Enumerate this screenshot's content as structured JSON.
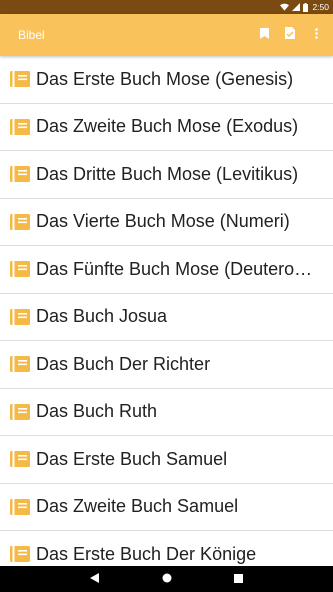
{
  "status_bar": {
    "time": "2:50"
  },
  "app_bar": {
    "title": "Bibel",
    "actions": [
      "bookmark-icon",
      "document-icon",
      "more-vert-icon"
    ]
  },
  "books": [
    "Das Erste Buch Mose (Genesis)",
    "Das Zweite Buch Mose (Exodus)",
    "Das Dritte Buch Mose (Levitikus)",
    "Das Vierte Buch Mose (Numeri)",
    "Das Fünfte Buch Mose (Deuteronomium)",
    "Das Buch Josua",
    "Das Buch Der Richter",
    "Das Buch Ruth",
    "Das Erste Buch Samuel",
    "Das Zweite Buch Samuel",
    "Das Erste Buch Der Könige"
  ],
  "colors": {
    "status_bar": "#7a4a12",
    "app_bar": "#f9c25a",
    "book_icon": "#f5b945",
    "nav_bar": "#000000"
  },
  "nav_bar": [
    "back-icon",
    "home-icon",
    "recents-icon"
  ]
}
